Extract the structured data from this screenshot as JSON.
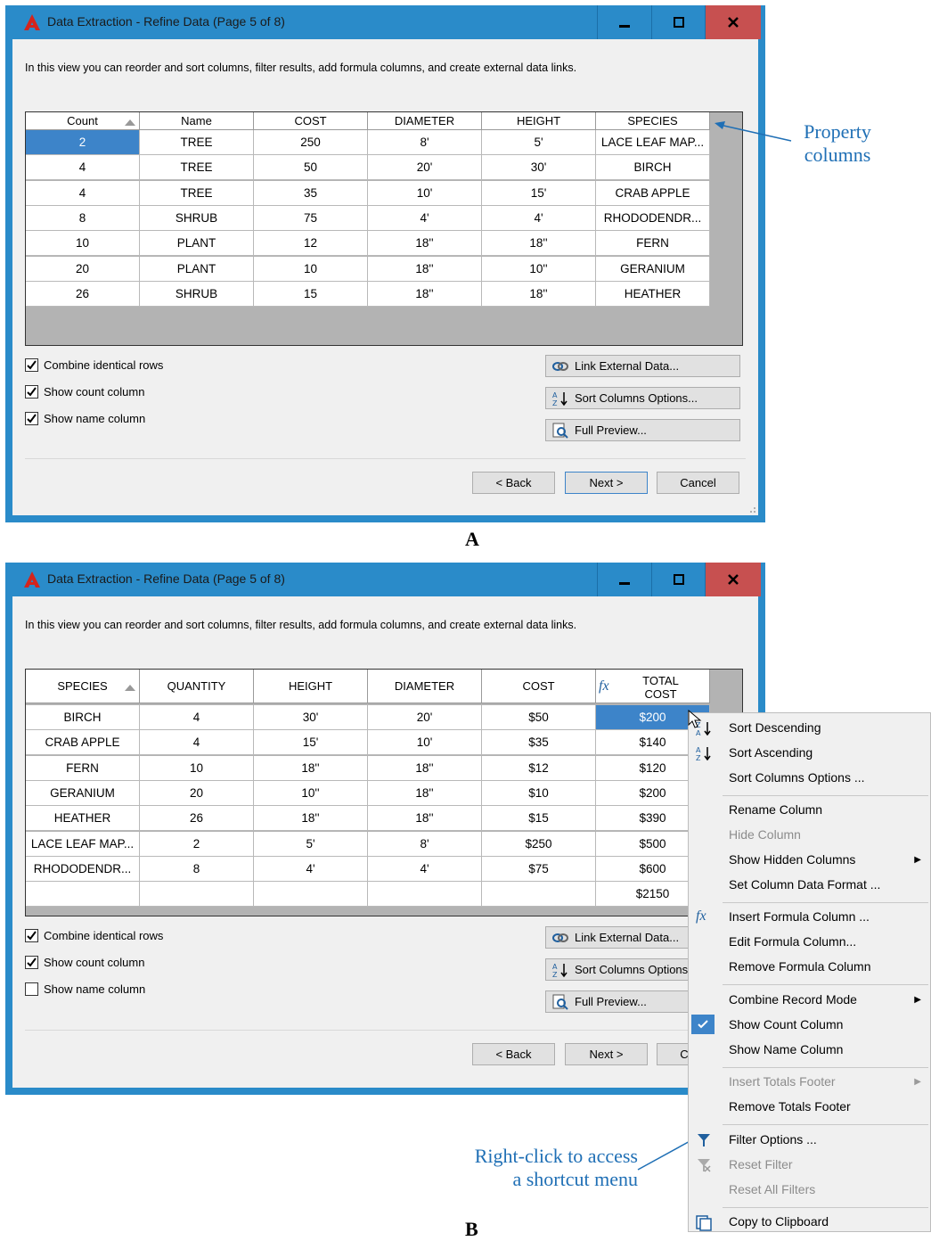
{
  "window_a": {
    "title": "Data Extraction - Refine Data (Page 5 of 8)",
    "description": "In this view you can reorder and sort columns, filter results, add formula columns, and create external data links.",
    "columns": [
      "Count",
      "Name",
      "COST",
      "DIAMETER",
      "HEIGHT",
      "SPECIES"
    ],
    "rows": [
      [
        "2",
        "TREE",
        "250",
        "8'",
        "5'",
        "LACE LEAF MAP..."
      ],
      [
        "4",
        "TREE",
        "50",
        "20'",
        "30'",
        "BIRCH"
      ],
      [
        "4",
        "TREE",
        "35",
        "10'",
        "15'",
        "CRAB APPLE"
      ],
      [
        "8",
        "SHRUB",
        "75",
        "4'",
        "4'",
        "RHODODENDR..."
      ],
      [
        "10",
        "PLANT",
        "12",
        "18''",
        "18''",
        "FERN"
      ],
      [
        "20",
        "PLANT",
        "10",
        "18''",
        "10''",
        "GERANIUM"
      ],
      [
        "26",
        "SHRUB",
        "15",
        "18''",
        "18''",
        "HEATHER"
      ]
    ],
    "checkboxes": [
      {
        "label": "Combine identical rows",
        "checked": true
      },
      {
        "label": "Show count column",
        "checked": true
      },
      {
        "label": "Show name column",
        "checked": true
      }
    ],
    "buttons": {
      "link_external": "Link External Data...",
      "sort_options": "Sort Columns Options...",
      "full_preview": "Full Preview...",
      "back": "< Back",
      "next": "Next >",
      "cancel": "Cancel"
    }
  },
  "window_b": {
    "title": "Data Extraction - Refine Data (Page 5 of 8)",
    "description": "In this view you can reorder and sort columns, filter results, add formula columns, and create external data links.",
    "columns": [
      "SPECIES",
      "QUANTITY",
      "HEIGHT",
      "DIAMETER",
      "COST",
      "TOTAL COST"
    ],
    "rows": [
      [
        "BIRCH",
        "4",
        "30'",
        "20'",
        "$50",
        "$200"
      ],
      [
        "CRAB APPLE",
        "4",
        "15'",
        "10'",
        "$35",
        "$140"
      ],
      [
        "FERN",
        "10",
        "18''",
        "18''",
        "$12",
        "$120"
      ],
      [
        "GERANIUM",
        "20",
        "10''",
        "18''",
        "$10",
        "$200"
      ],
      [
        "HEATHER",
        "26",
        "18''",
        "18''",
        "$15",
        "$390"
      ],
      [
        "LACE LEAF MAP...",
        "2",
        "5'",
        "8'",
        "$250",
        "$500"
      ],
      [
        "RHODODENDR...",
        "8",
        "4'",
        "4'",
        "$75",
        "$600"
      ],
      [
        "",
        "",
        "",
        "",
        "",
        "$2150"
      ]
    ],
    "checkboxes": [
      {
        "label": "Combine identical rows",
        "checked": true
      },
      {
        "label": "Show count column",
        "checked": true
      },
      {
        "label": "Show name column",
        "checked": false
      }
    ],
    "buttons": {
      "link_external": "Link External Data...",
      "sort_options": "Sort Columns Options...",
      "full_preview": "Full Preview...",
      "back": "< Back",
      "next": "Next >",
      "cancel": "Cancel"
    }
  },
  "context_menu": {
    "items": [
      {
        "label": "Sort Descending",
        "enabled": true
      },
      {
        "label": "Sort Ascending",
        "enabled": true
      },
      {
        "label": "Sort Columns Options ...",
        "enabled": true
      },
      {
        "label": "Rename Column",
        "enabled": true
      },
      {
        "label": "Hide Column",
        "enabled": false
      },
      {
        "label": "Show Hidden Columns",
        "enabled": true,
        "submenu": true
      },
      {
        "label": "Set Column Data Format ...",
        "enabled": true
      },
      {
        "label": "Insert Formula Column ...",
        "enabled": true
      },
      {
        "label": "Edit Formula Column...",
        "enabled": true
      },
      {
        "label": "Remove Formula Column",
        "enabled": true
      },
      {
        "label": "Combine Record Mode",
        "enabled": true,
        "submenu": true
      },
      {
        "label": "Show Count Column",
        "enabled": true,
        "checked": true
      },
      {
        "label": "Show Name Column",
        "enabled": true
      },
      {
        "label": "Insert Totals Footer",
        "enabled": false,
        "submenu": true
      },
      {
        "label": "Remove Totals Footer",
        "enabled": true
      },
      {
        "label": "Filter Options ...",
        "enabled": true
      },
      {
        "label": "Reset Filter",
        "enabled": false
      },
      {
        "label": "Reset All Filters",
        "enabled": false
      },
      {
        "label": "Copy to Clipboard",
        "enabled": true
      }
    ]
  },
  "labels": {
    "a": "A",
    "b": "B",
    "callout_property_1": "Property",
    "callout_property_2": "columns",
    "callout_rightclick_1": "Right-click to access",
    "callout_rightclick_2": "a shortcut menu",
    "fx_symbol": "fx"
  },
  "colors": {
    "title_bar": "#2a8bc9",
    "close_button": "#c75050",
    "selection": "#3d84c9",
    "callout": "#1f6fb5"
  }
}
